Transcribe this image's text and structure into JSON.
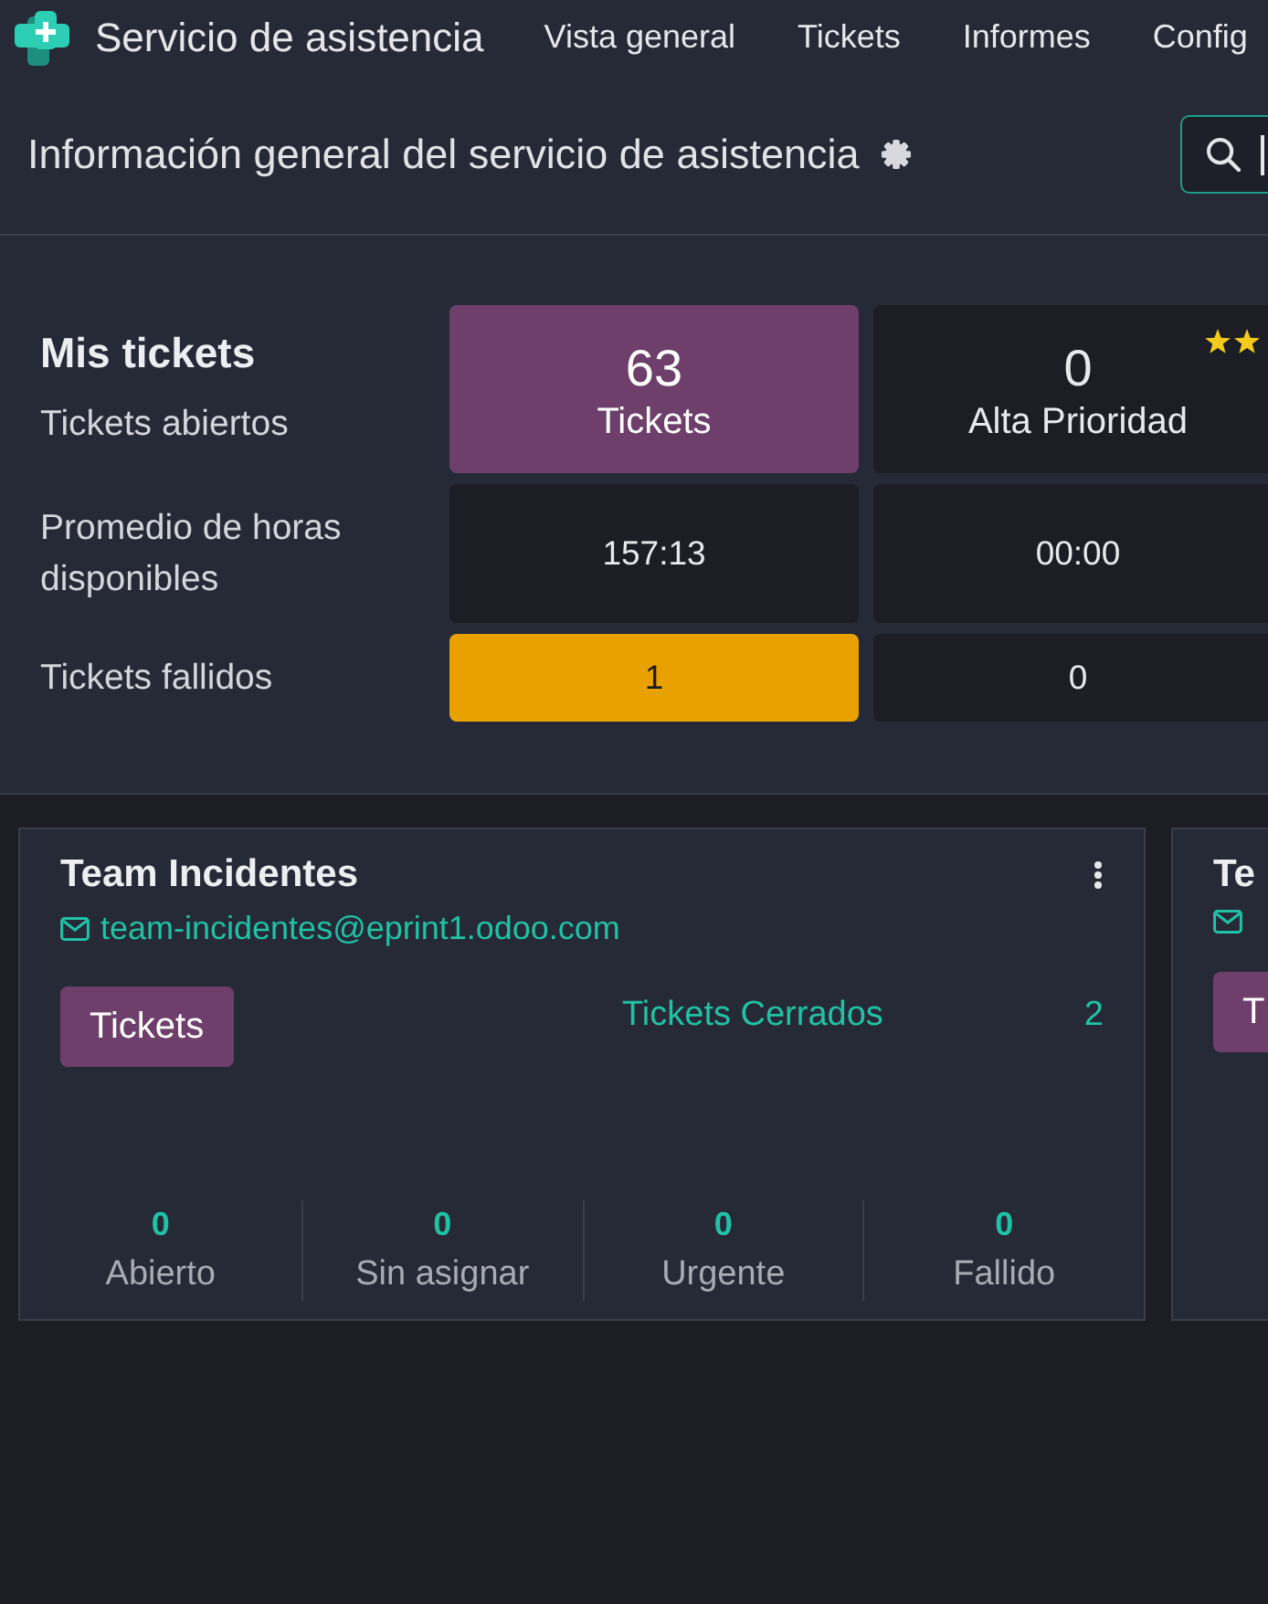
{
  "navbar": {
    "app_name": "Servicio de asistencia",
    "menu": [
      {
        "label": "Vista general"
      },
      {
        "label": "Tickets"
      },
      {
        "label": "Informes"
      },
      {
        "label": "Config"
      }
    ]
  },
  "control_panel": {
    "title": "Información general del servicio de asistencia"
  },
  "my_tickets": {
    "title": "Mis tickets",
    "rows": [
      {
        "label": "Tickets abiertos",
        "cells": [
          {
            "kind": "primary",
            "value": "63",
            "caption": "Tickets"
          },
          {
            "kind": "priority",
            "value": "0",
            "caption": "Alta Prioridad"
          }
        ]
      },
      {
        "label": "Promedio de horas disponibles",
        "cells": [
          {
            "kind": "plain",
            "value": "157:13"
          },
          {
            "kind": "plain",
            "value": "00:00"
          }
        ]
      },
      {
        "label": "Tickets fallidos",
        "cells": [
          {
            "kind": "warning",
            "value": "1"
          },
          {
            "kind": "plain",
            "value": "0"
          }
        ]
      }
    ]
  },
  "teams": [
    {
      "name": "Team Incidentes",
      "email": "team-incidentes@eprint1.odoo.com",
      "button": "Tickets",
      "closed_label": "Tickets Cerrados",
      "closed_count": "2",
      "stats": [
        {
          "value": "0",
          "label": "Abierto"
        },
        {
          "value": "0",
          "label": "Sin asignar"
        },
        {
          "value": "0",
          "label": "Urgente"
        },
        {
          "value": "0",
          "label": "Fallido"
        }
      ]
    },
    {
      "name": "Te",
      "button": "T"
    }
  ]
}
